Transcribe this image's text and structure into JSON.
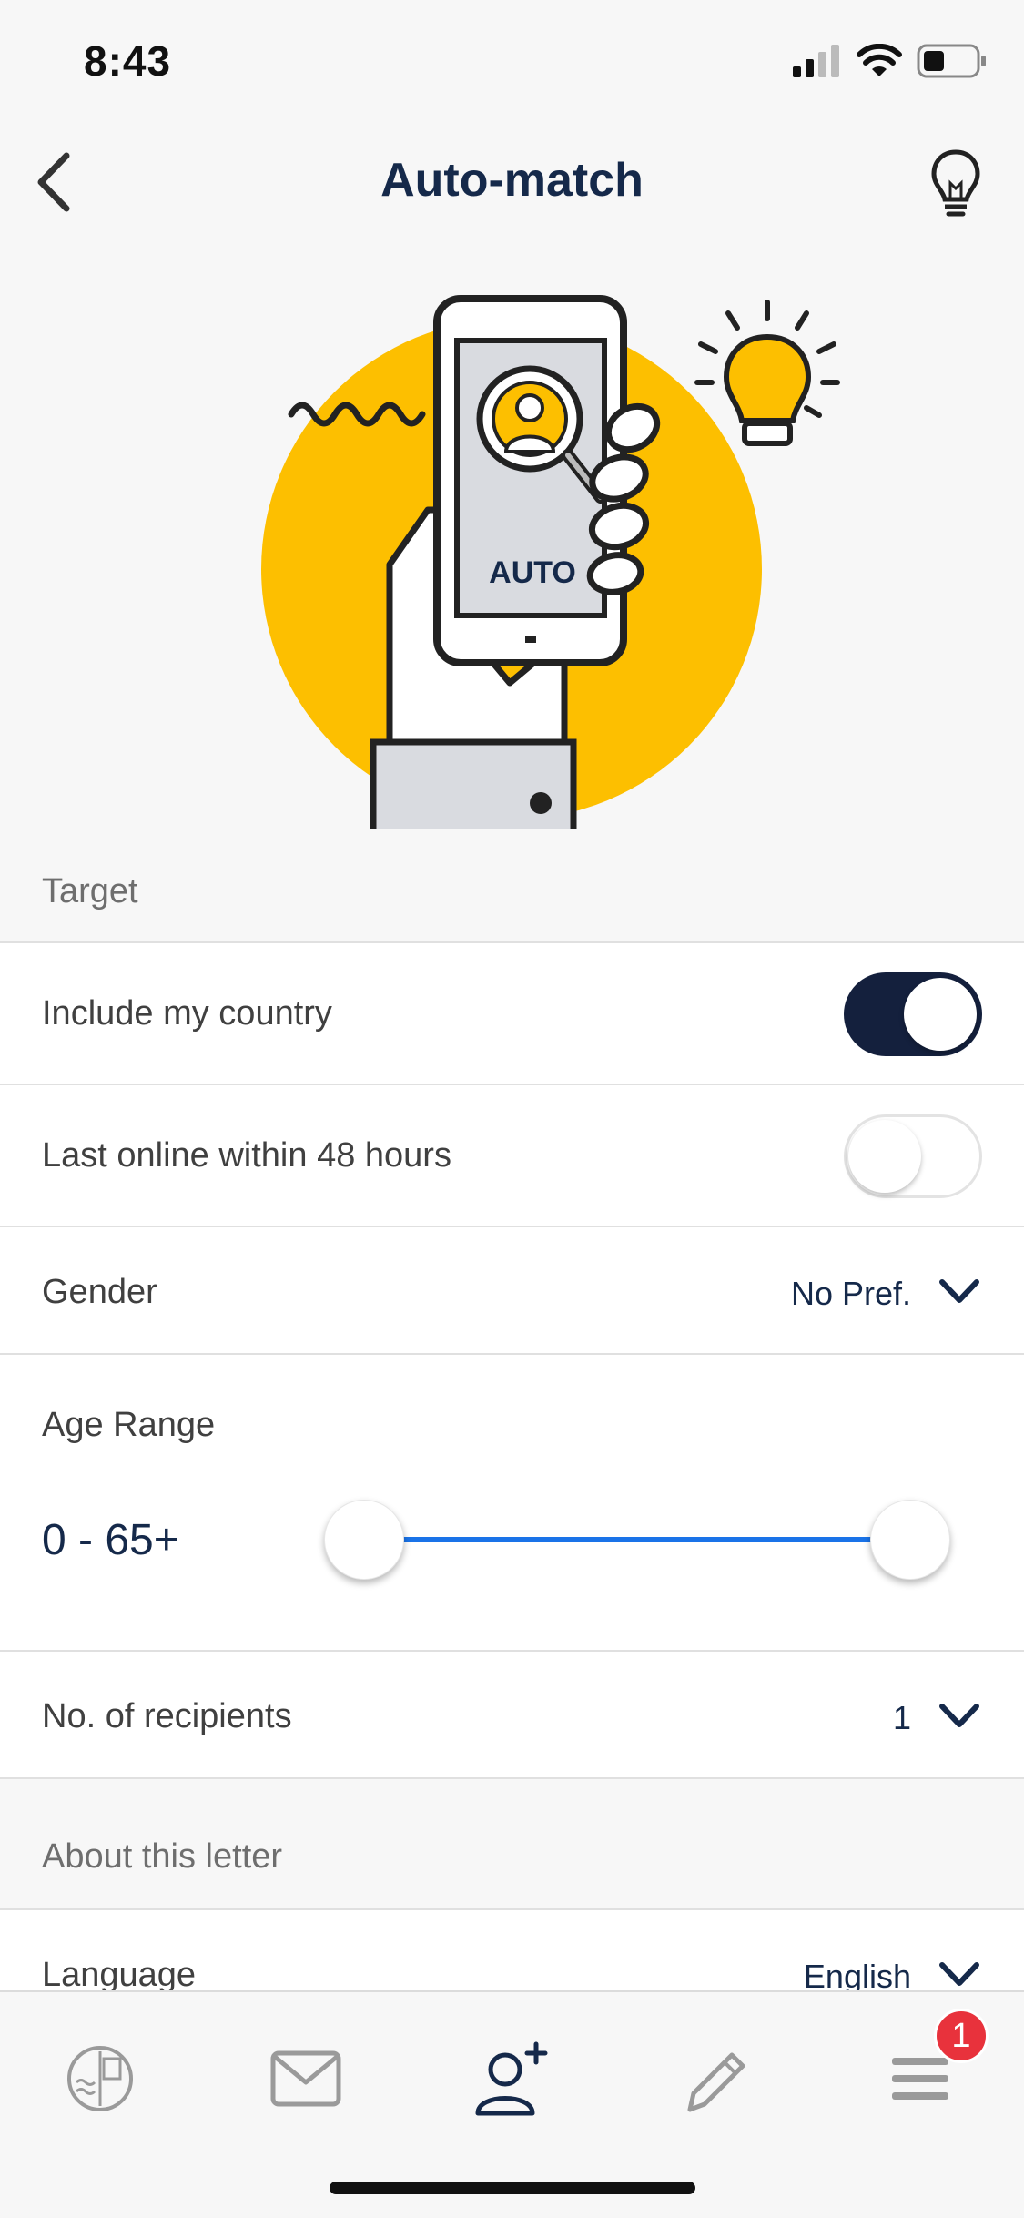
{
  "status_bar": {
    "time": "8:43"
  },
  "nav": {
    "title": "Auto-match",
    "back_icon": "chevron-left-icon",
    "tip_icon": "lightbulb-icon"
  },
  "hero": {
    "phone_text": "AUTO",
    "accent_color": "#fdbf00"
  },
  "sections": {
    "target": "Target",
    "about": "About this letter"
  },
  "settings": {
    "include_country": {
      "label": "Include my country",
      "enabled": true
    },
    "last_online": {
      "label": "Last online within 48 hours",
      "enabled": false
    },
    "gender": {
      "label": "Gender",
      "value": "No Pref."
    },
    "age_range": {
      "label": "Age Range",
      "value": "0 - 65+",
      "min": 0,
      "max": "65+"
    },
    "recipients": {
      "label": "No. of recipients",
      "value": "1"
    },
    "language": {
      "label": "Language",
      "value": "English"
    }
  },
  "tab_bar": {
    "items": [
      {
        "name": "stamp-tab",
        "icon": "stamp-icon"
      },
      {
        "name": "letters-tab",
        "icon": "envelope-icon"
      },
      {
        "name": "add-friend-tab",
        "icon": "user-plus-icon"
      },
      {
        "name": "write-tab",
        "icon": "pencil-icon"
      },
      {
        "name": "menu-tab",
        "icon": "menu-icon",
        "badge": "1"
      }
    ]
  },
  "colors": {
    "primary": "#15294a",
    "toggle_on": "#14203d",
    "slider": "#1a73e8",
    "badge": "#e8323c"
  }
}
